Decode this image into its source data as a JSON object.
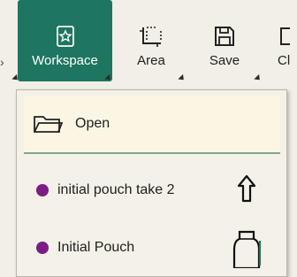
{
  "ribbon": {
    "workspace": {
      "label": "Workspace",
      "icon": "workspace-icon"
    },
    "area": {
      "label": "Area",
      "icon": "area-select-icon"
    },
    "save": {
      "label": "Save",
      "icon": "floppy-disk-icon"
    },
    "cl": {
      "label": "Cl"
    }
  },
  "dropdown": {
    "open_label": "Open",
    "items": [
      {
        "label": "initial pouch take 2",
        "dot_color": "#7c1d86"
      },
      {
        "label": "Initial Pouch",
        "dot_color": "#7c1d86"
      }
    ]
  },
  "colors": {
    "accent": "#1e7560",
    "background": "#f2efe6",
    "dot": "#7c1d86"
  }
}
